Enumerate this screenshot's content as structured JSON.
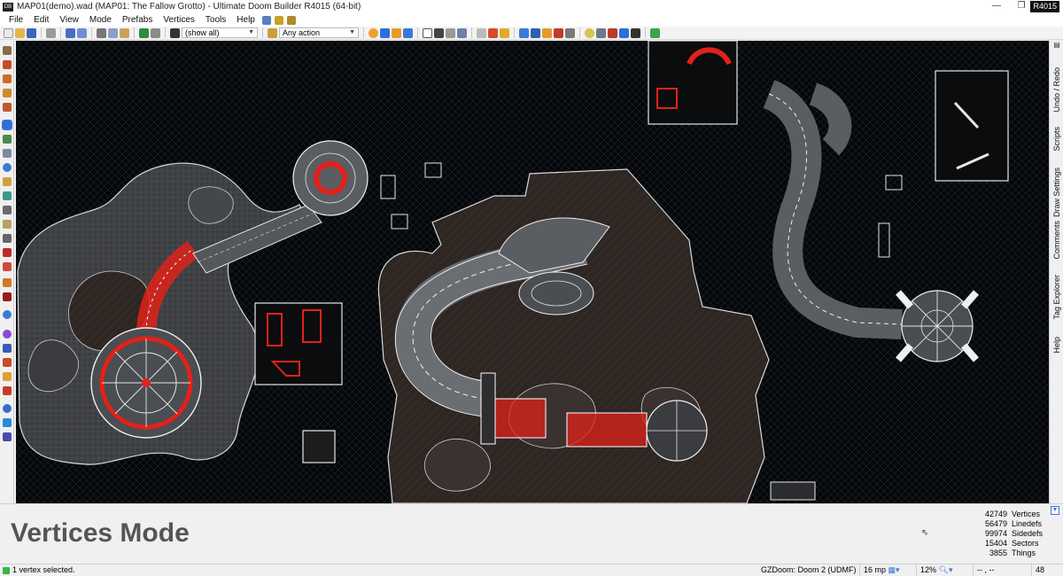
{
  "window": {
    "title": "MAP01(demo).wad (MAP01: The Fallow Grotto) - Ultimate Doom Builder R4015 (64-bit)",
    "revision_badge": "R4015",
    "minimize": "—",
    "restore": "❐",
    "close": "✕"
  },
  "menu": [
    "File",
    "Edit",
    "View",
    "Mode",
    "Prefabs",
    "Vertices",
    "Tools",
    "Help"
  ],
  "toolbar": {
    "filter_value": "(show all)",
    "action_value": "Any action"
  },
  "right_tabs": [
    "Undo / Redo",
    "Scripts",
    "Draw Settings",
    "Comments",
    "Tag Explorer",
    "Help"
  ],
  "info": {
    "mode_title": "Vertices Mode",
    "stats": [
      {
        "value": "42749",
        "label": "Vertices"
      },
      {
        "value": "56479",
        "label": "Linedefs"
      },
      {
        "value": "99974",
        "label": "Sidedefs"
      },
      {
        "value": "15404",
        "label": "Sectors"
      },
      {
        "value": "3855",
        "label": "Things"
      }
    ]
  },
  "status": {
    "message": "1 vertex selected.",
    "engine": "GZDoom: Doom 2 (UDMF)",
    "grid": "16 mp",
    "zoom": "12%",
    "coords": "-- , --",
    "value": "48"
  },
  "colors": {
    "accent": "#3b78d8",
    "selection": "#e0221a",
    "map_background": "#050607"
  }
}
